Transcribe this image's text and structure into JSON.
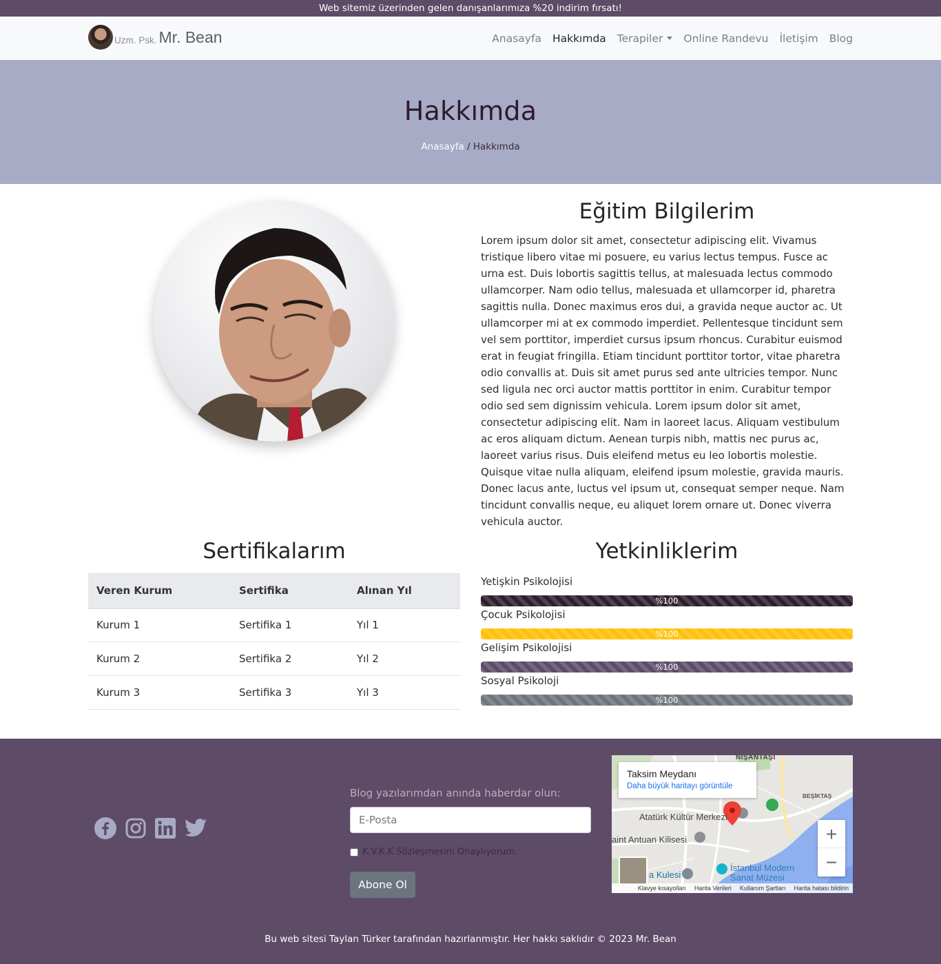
{
  "promo": {
    "text": "Web sitemiz üzerinden gelen danışanlarımıza %20 indirim fırsatı!"
  },
  "brand": {
    "prefix": "Uzm. Psk.",
    "name": "Mr. Bean"
  },
  "nav": {
    "items": [
      {
        "label": "Anasayfa",
        "active": false
      },
      {
        "label": "Hakkımda",
        "active": true
      },
      {
        "label": "Terapiler",
        "active": false
      },
      {
        "label": "Online Randevu",
        "active": false
      },
      {
        "label": "İletişim",
        "active": false
      },
      {
        "label": "Blog",
        "active": false
      }
    ]
  },
  "hero": {
    "title": "Hakkımda",
    "breadcrumb_home": "Anasayfa",
    "breadcrumb_sep": " / ",
    "breadcrumb_current": "Hakkımda"
  },
  "about": {
    "title": "Eğitim Bilgilerim",
    "text": "Lorem ipsum dolor sit amet, consectetur adipiscing elit. Vivamus tristique libero vitae mi posuere, eu varius lectus tempus. Fusce ac urna est. Duis lobortis sagittis tellus, at malesuada lectus commodo ullamcorper. Nam odio tellus, malesuada et ullamcorper id, pharetra sagittis nulla. Donec maximus eros dui, a gravida neque auctor ac. Ut ullamcorper mi at ex commodo imperdiet. Pellentesque tincidunt sem vel sem porttitor, imperdiet cursus ipsum rhoncus. Curabitur euismod erat in feugiat fringilla. Etiam tincidunt porttitor tortor, vitae pharetra odio convallis at. Duis sit amet purus sed ante ultricies tempor. Nunc sed ligula nec orci auctor mattis porttitor in enim. Curabitur tempor odio sed sem dignissim vehicula. Lorem ipsum dolor sit amet, consectetur adipiscing elit. Nam in laoreet lacus. Aliquam vestibulum ac eros aliquam dictum. Aenean turpis nibh, mattis nec purus ac, laoreet varius risus. Duis eleifend metus eu leo lobortis molestie. Quisque vitae nulla aliquam, eleifend ipsum molestie, gravida mauris. Donec lacus ante, luctus vel ipsum ut, consequat semper neque. Nam tincidunt convallis neque, eu aliquet lorem ornare ut. Donec viverra vehicula auctor."
  },
  "certificates": {
    "title": "Sertifikalarım",
    "headers": [
      "Veren Kurum",
      "Sertifika",
      "Alınan Yıl"
    ],
    "rows": [
      [
        "Kurum 1",
        "Sertifika 1",
        "Yıl 1"
      ],
      [
        "Kurum 2",
        "Sertifika 2",
        "Yıl 2"
      ],
      [
        "Kurum 3",
        "Sertifika 3",
        "Yıl 3"
      ]
    ]
  },
  "skills": {
    "title": "Yetkinliklerim",
    "items": [
      {
        "label": "Yetişkin Psikolojisi",
        "value_text": "%100",
        "percent": 100,
        "color": "#2f1e2d"
      },
      {
        "label": "Çocuk Psikolojisi",
        "value_text": "%100",
        "percent": 100,
        "color": "#ffc107"
      },
      {
        "label": "Gelişim Psikolojisi",
        "value_text": "%100",
        "percent": 100,
        "color": "#5e4b68"
      },
      {
        "label": "Sosyal Psikoloji",
        "value_text": "%100",
        "percent": 100,
        "color": "#6c757d"
      }
    ]
  },
  "footer": {
    "social_icons": [
      "facebook-icon",
      "instagram-icon",
      "linkedin-icon",
      "twitter-icon"
    ],
    "subscribe_label": "Blog yazılarımdan anında haberdar olun:",
    "email_placeholder": "E-Posta",
    "kvkk_label": "K.V.K.K Sözleşmesini Onaylıyorum.",
    "subscribe_button": "Abone Ol",
    "copyright": "Bu web sitesi Taylan Türker tarafından hazırlanmıştır. Her hakkı saklıdır © 2023 Mr. Bean"
  },
  "map": {
    "place_title": "Taksim Meydanı",
    "larger_map_link": "Daha büyük haritayı görüntüle",
    "labels": [
      "NIŞANTAŞI",
      "BEŞİKTAŞ",
      "Atatürk Kültür Merkezi",
      "aint Antuan Kilisesi",
      "a Kulesi",
      "İstanbul Modern Sanat Müzesi"
    ],
    "zoom_in": "+",
    "zoom_out": "−",
    "footer_links": [
      "Klavye kısayolları",
      "Harita Verileri",
      "Kullanım Şartları",
      "Harita hatası bildirin"
    ]
  }
}
